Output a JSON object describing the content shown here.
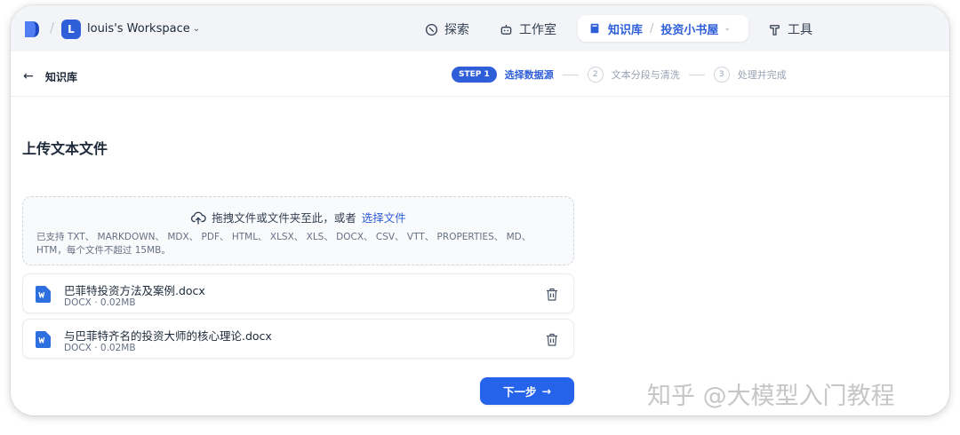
{
  "topnav": {
    "workspace_initial": "L",
    "workspace_name": "louis's Workspace",
    "items": [
      {
        "label": "探索",
        "icon": "compass-icon"
      },
      {
        "label": "工作室",
        "icon": "robot-icon"
      },
      {
        "label": "工具",
        "icon": "hammer-icon"
      }
    ],
    "knowledge_label": "知识库",
    "knowledge_current": "投资小书屋"
  },
  "subheader": {
    "title": "知识库",
    "steps": [
      {
        "badge": "STEP 1",
        "label": "选择数据源",
        "active": true
      },
      {
        "badge": "2",
        "label": "文本分段与清洗",
        "active": false
      },
      {
        "badge": "3",
        "label": "处理并完成",
        "active": false
      }
    ]
  },
  "main": {
    "title": "上传文本文件",
    "dropzone": {
      "prompt": "拖拽文件或文件夹至此，或者",
      "link": "选择文件",
      "hint": "已支持 TXT、 MARKDOWN、 MDX、 PDF、 HTML、 XLSX、 XLS、 DOCX、 CSV、 VTT、 PROPERTIES、 MD、 HTM，每个文件不超过 15MB。"
    },
    "files": [
      {
        "name": "巴菲特投资方法及案例.docx",
        "meta": "DOCX · 0.02MB"
      },
      {
        "name": "与巴菲特齐名的投资大师的核心理论.docx",
        "meta": "DOCX · 0.02MB"
      }
    ],
    "next_button": "下一步"
  },
  "watermark": "知乎 @大模型入门教程",
  "colors": {
    "accent": "#2f5fd8",
    "button": "#2563eb",
    "nav_bg": "#f2f4f7"
  }
}
